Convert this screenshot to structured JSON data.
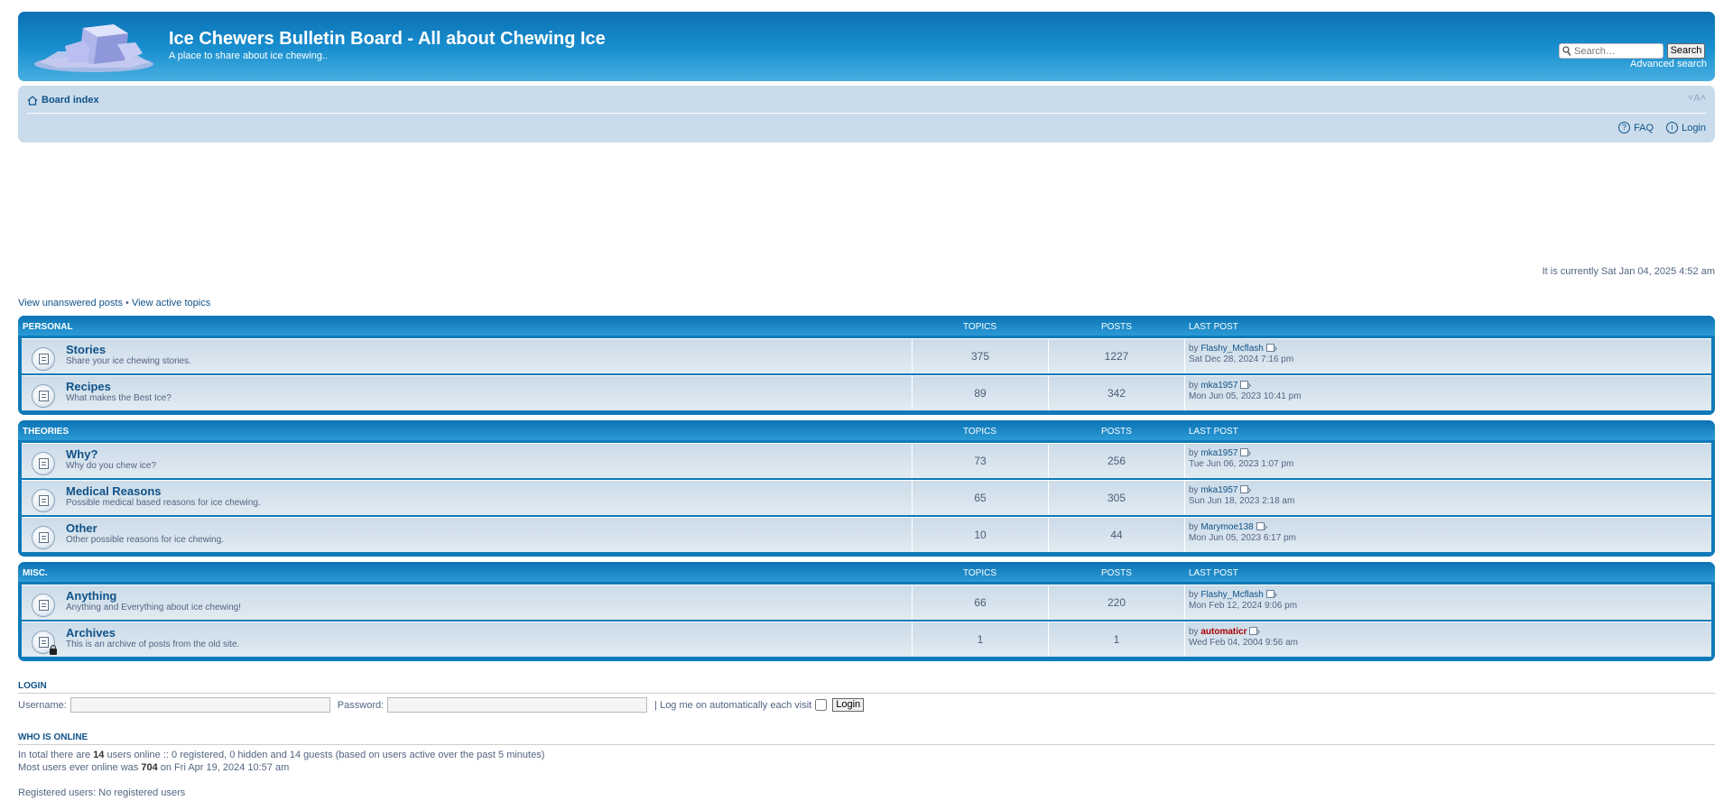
{
  "header": {
    "title": "Ice Chewers Bulletin Board - All about Chewing Ice",
    "description": "A place to share about ice chewing..",
    "search_placeholder": "Search…",
    "search_button": "Search",
    "advanced_search": "Advanced search"
  },
  "nav": {
    "board_index": "Board index",
    "font_resize": "˅A˄",
    "faq": "FAQ",
    "login": "Login"
  },
  "current_time": "It is currently Sat Jan 04, 2025 4:52 am",
  "quick_links": {
    "unanswered": "View unanswered posts",
    "separator": "•",
    "active": "View active topics"
  },
  "columns": {
    "topics": "TOPICS",
    "posts": "POSTS",
    "last_post": "LAST POST"
  },
  "categories": [
    {
      "name": "PERSONAL",
      "forums": [
        {
          "title": "Stories",
          "desc": "Share your ice chewing stories.",
          "topics": "375",
          "posts": "1227",
          "by": "by",
          "user": "Flashy_Mcflash",
          "date": "Sat Dec 28, 2024 7:16 pm"
        },
        {
          "title": "Recipes",
          "desc": "What makes the Best Ice?",
          "topics": "89",
          "posts": "342",
          "by": "by",
          "user": "mka1957",
          "date": "Mon Jun 05, 2023 10:41 pm"
        }
      ]
    },
    {
      "name": "THEORIES",
      "forums": [
        {
          "title": "Why?",
          "desc": "Why do you chew ice?",
          "topics": "73",
          "posts": "256",
          "by": "by",
          "user": "mka1957",
          "date": "Tue Jun 06, 2023 1:07 pm"
        },
        {
          "title": "Medical Reasons",
          "desc": "Possible medical based reasons for ice chewing.",
          "topics": "65",
          "posts": "305",
          "by": "by",
          "user": "mka1957",
          "date": "Sun Jun 18, 2023 2:18 am"
        },
        {
          "title": "Other",
          "desc": "Other possible reasons for ice chewing.",
          "topics": "10",
          "posts": "44",
          "by": "by",
          "user": "Marymoe138",
          "date": "Mon Jun 05, 2023 6:17 pm"
        }
      ]
    },
    {
      "name": "MISC.",
      "forums": [
        {
          "title": "Anything",
          "desc": "Anything and Everything about ice chewing!",
          "topics": "66",
          "posts": "220",
          "by": "by",
          "user": "Flashy_Mcflash",
          "date": "Mon Feb 12, 2024 9:06 pm"
        },
        {
          "title": "Archives",
          "desc": "This is an archive of posts from the old site.",
          "topics": "1",
          "posts": "1",
          "by": "by",
          "user": "automaticr",
          "date": "Wed Feb 04, 2004 9:56 am"
        }
      ]
    }
  ],
  "login": {
    "title": "LOGIN",
    "username_label": "Username:",
    "password_label": "Password:",
    "remember_label": "| Log me on automatically each visit",
    "button": "Login"
  },
  "online": {
    "title": "WHO IS ONLINE",
    "line1_pre": "In total there are",
    "line1_count": "14",
    "line1_post": "users online :: 0 registered, 0 hidden and 14 guests (based on users active over the past 5 minutes)",
    "line2_pre": "Most users ever online was",
    "line2_count": "704",
    "line2_post": "on Fri Apr 19, 2024 10:57 am",
    "registered": "Registered users: No registered users"
  },
  "colors": {
    "header_blue": "#0a71b4",
    "navbar_bg": "#cadceb",
    "link": "#105289",
    "admin_user": "#aa0000"
  },
  "icons": [
    "ice-cube-logo",
    "magnifier-icon",
    "home-icon",
    "faq-icon",
    "login-icon",
    "forum-read-icon",
    "forum-locked-icon",
    "view-latest-post-icon"
  ]
}
